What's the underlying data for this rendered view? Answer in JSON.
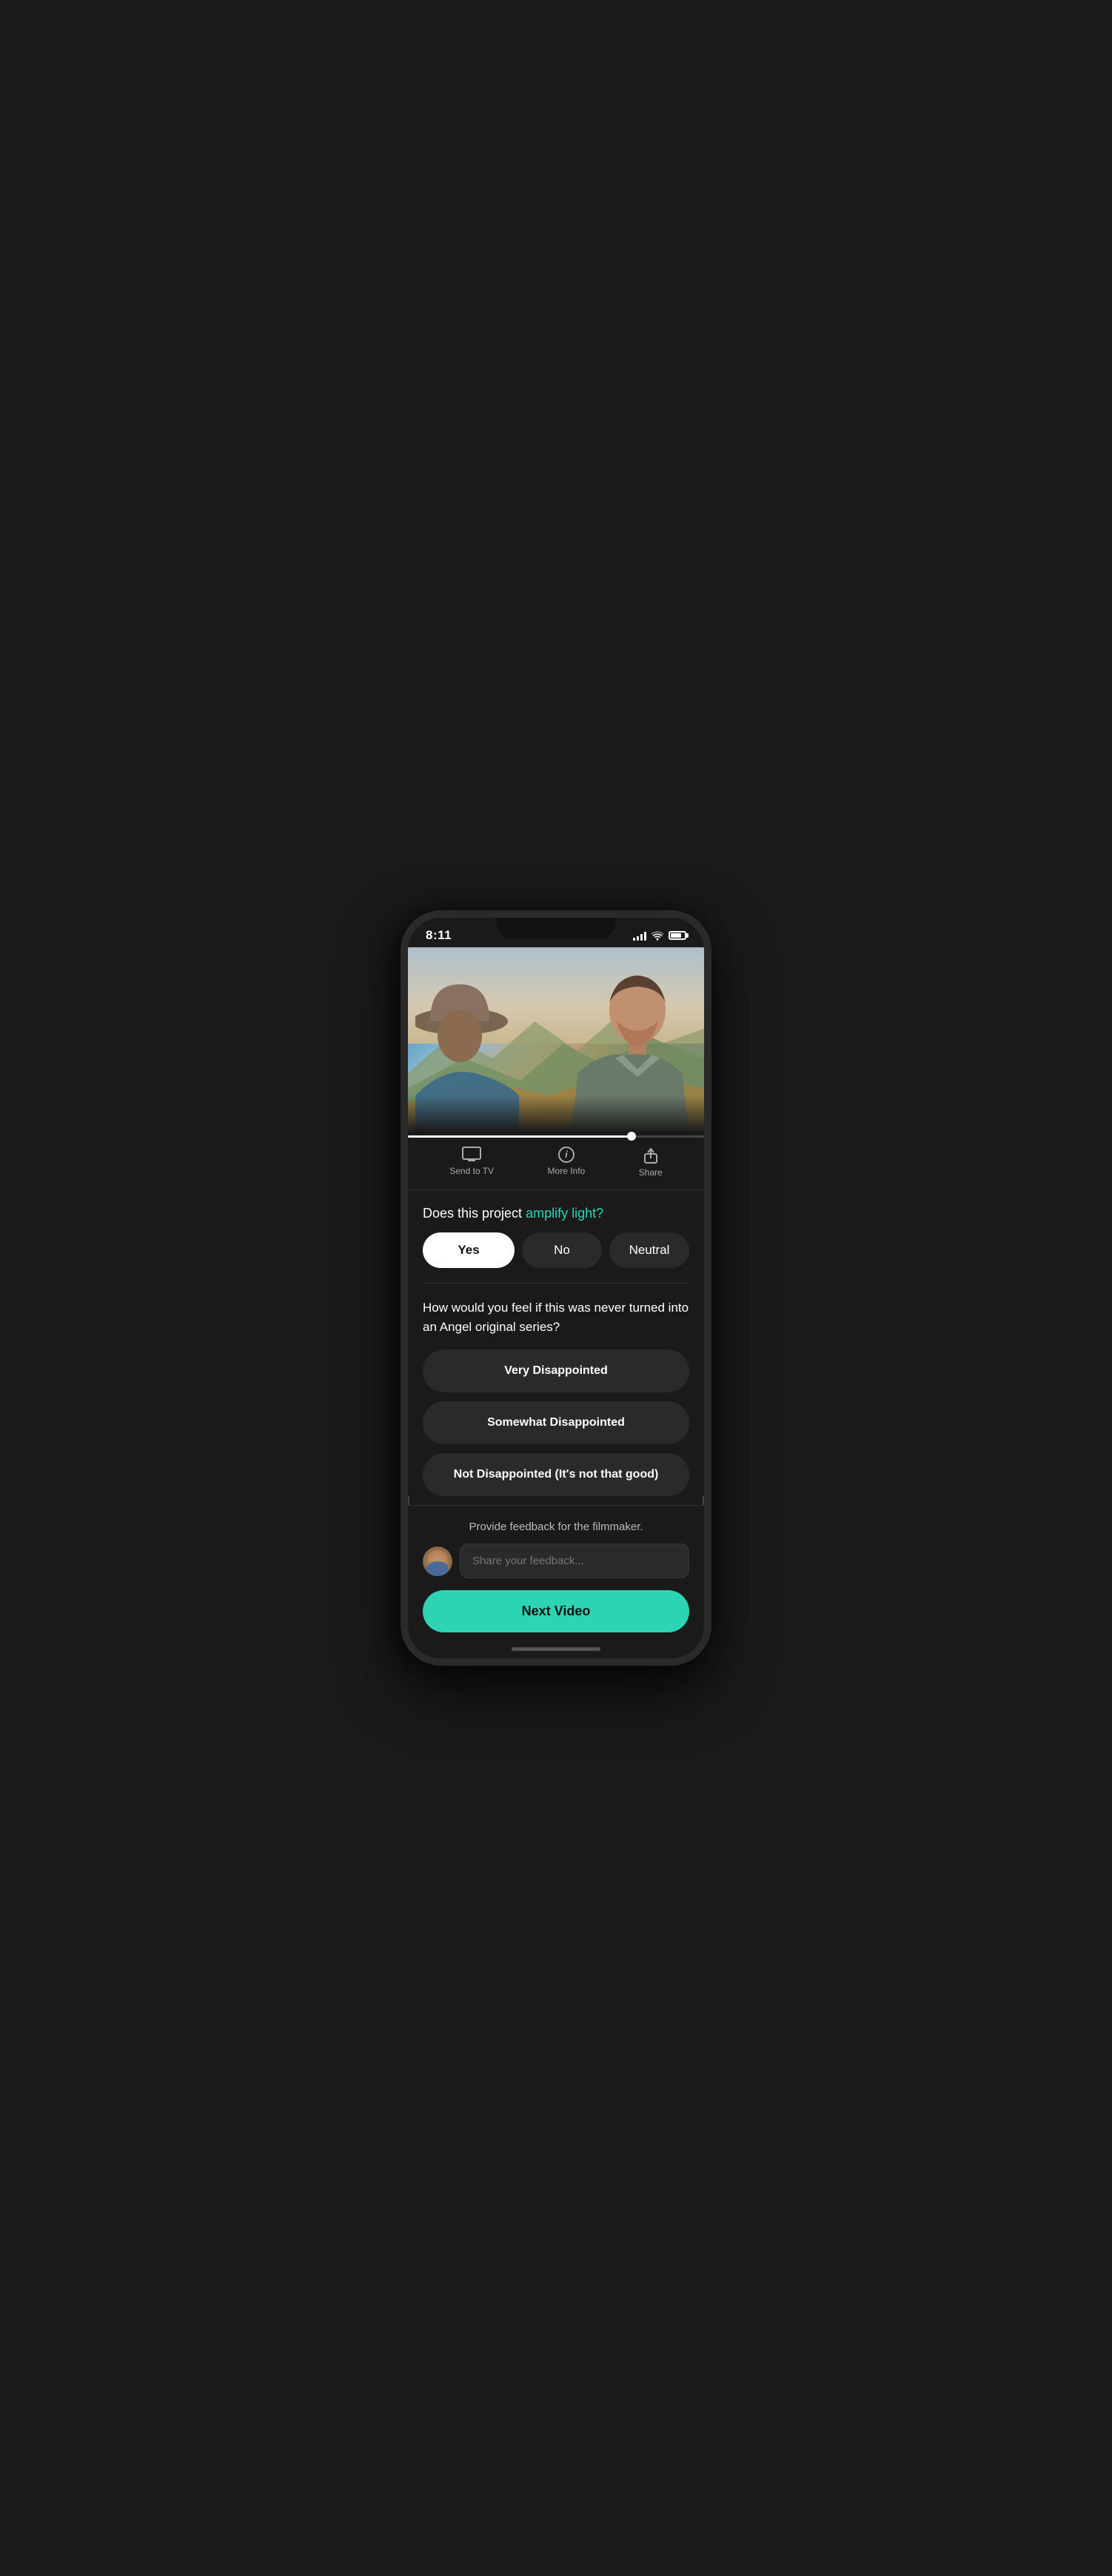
{
  "statusBar": {
    "time": "8:11",
    "signalBars": [
      4,
      6,
      9,
      12,
      14
    ],
    "batteryLevel": 80
  },
  "actionBar": {
    "sendToTV": "Send to TV",
    "moreInfo": "More Info",
    "share": "Share"
  },
  "amplifySection": {
    "questionPrefix": "Does this project ",
    "questionHighlight": "amplify light?",
    "yesLabel": "Yes",
    "noLabel": "No",
    "neutralLabel": "Neutral"
  },
  "feelingSection": {
    "question": "How would you feel if this was never turned into an Angel original series?",
    "options": [
      "Very Disappointed",
      "Somewhat Disappointed",
      "Not Disappointed (It's not that good)"
    ]
  },
  "feedbackSection": {
    "label": "Provide feedback for the filmmaker.",
    "inputPlaceholder": "Share your feedback...",
    "nextVideoLabel": "Next Video"
  },
  "colors": {
    "teal": "#2dd4b4",
    "darkBg": "#1a1a1a",
    "cardBg": "#2a2a2a",
    "white": "#ffffff",
    "textMuted": "#aaaaaa"
  }
}
